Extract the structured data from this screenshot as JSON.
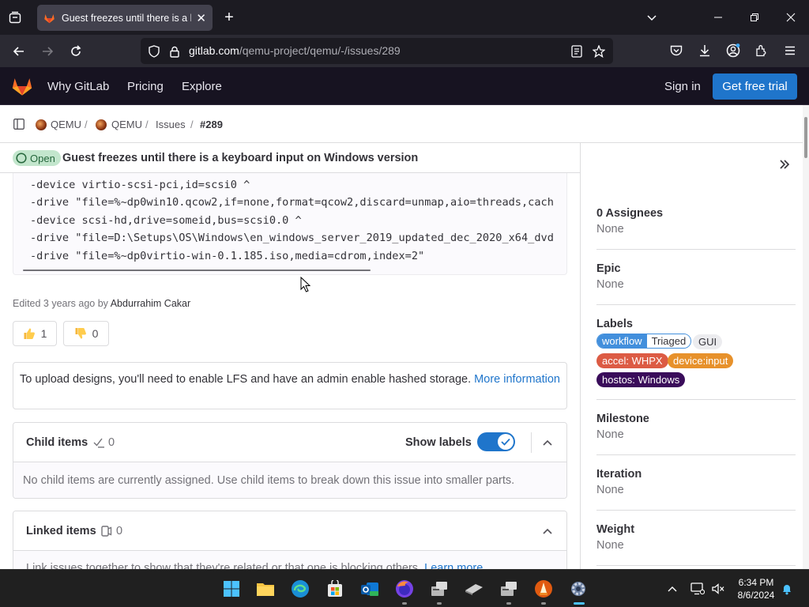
{
  "browser": {
    "tab_title": "Guest freezes until there is a keyboard input on Windows version",
    "url_host": "gitlab.com",
    "url_path": "/qemu-project/qemu/-/issues/289"
  },
  "gitlab_nav": {
    "why": "Why GitLab",
    "pricing": "Pricing",
    "explore": "Explore",
    "sign_in": "Sign in",
    "trial": "Get free trial"
  },
  "breadcrumb": {
    "group": "QEMU",
    "project": "QEMU",
    "issues": "Issues",
    "issue": "#289"
  },
  "issue": {
    "status": "Open",
    "title": "Guest freezes until there is a keyboard input on Windows version"
  },
  "code_lines": [
    "-device virtio-scsi-pci,id=scsi0 ^",
    "-drive \"file=%~dp0win10.qcow2,if=none,format=qcow2,discard=unmap,aio=threads,cach",
    "-device scsi-hd,drive=someid,bus=scsi0.0 ^",
    "-drive \"file=D:\\Setups\\OS\\Windows\\en_windows_server_2019_updated_dec_2020_x64_dvd",
    "-drive \"file=%~dp0virtio-win-0.1.185.iso,media=cdrom,index=2\""
  ],
  "edited": {
    "prefix": "Edited 3 years ago by",
    "author": "Abdurrahim Cakar"
  },
  "reactions": {
    "thumbs_up": "1",
    "thumbs_down": "0"
  },
  "lfs": {
    "text": "To upload designs, you'll need to enable LFS and have an admin enable hashed storage.",
    "link": "More information"
  },
  "child_items": {
    "title": "Child items",
    "count": "0",
    "show_labels": "Show labels",
    "empty": "No child items are currently assigned. Use child items to break down this issue into smaller parts."
  },
  "linked_items": {
    "title": "Linked items",
    "count": "0",
    "body": "Link issues together to show that they're related or that one is blocking others.",
    "link": "Learn more."
  },
  "sidebar": {
    "assignees_title": "0 Assignees",
    "assignees_value": "None",
    "epic_title": "Epic",
    "epic_value": "None",
    "labels_title": "Labels",
    "labels": {
      "workflow_scope": "workflow",
      "workflow_value": "Triaged",
      "gui": "GUI",
      "accel": "accel: WHPX",
      "device": "device:input",
      "hostos": "hostos: Windows"
    },
    "milestone_title": "Milestone",
    "milestone_value": "None",
    "iteration_title": "Iteration",
    "iteration_value": "None",
    "weight_title": "Weight",
    "weight_value": "None"
  },
  "taskbar": {
    "time": "6:34 PM",
    "date": "8/6/2024"
  },
  "colors": {
    "gitlab_dark": "#171321",
    "primary_blue": "#1f75cb",
    "open_badge": "#c3e6cd",
    "label_workflow": "#428fdc",
    "label_accel": "#dc5b44",
    "label_device": "#e7912b",
    "label_hostos": "#3a0c5a"
  }
}
